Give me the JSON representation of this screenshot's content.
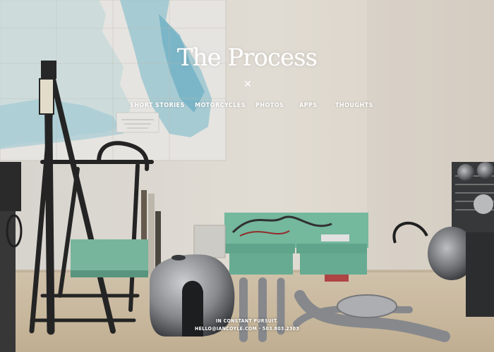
{
  "site": {
    "title": "The Process"
  },
  "nav": {
    "close_icon": "close-icon",
    "items": [
      {
        "label": "SHORT STORIES"
      },
      {
        "label": "MOTORCYCLES"
      },
      {
        "label": "PHOTOS"
      },
      {
        "label": "APPS"
      },
      {
        "label": "THOUGHTS"
      }
    ]
  },
  "footer": {
    "tagline": "IN CONSTANT PURSUIT.",
    "contact": "HELLO@IANCOYLE.COM · 503.803.2303"
  },
  "colors": {
    "text": "#ffffff",
    "wall": "#ebe7e0",
    "map_water": "#8fc6d6",
    "tray": "#7cc3a8",
    "table": "#d8c9b0"
  }
}
